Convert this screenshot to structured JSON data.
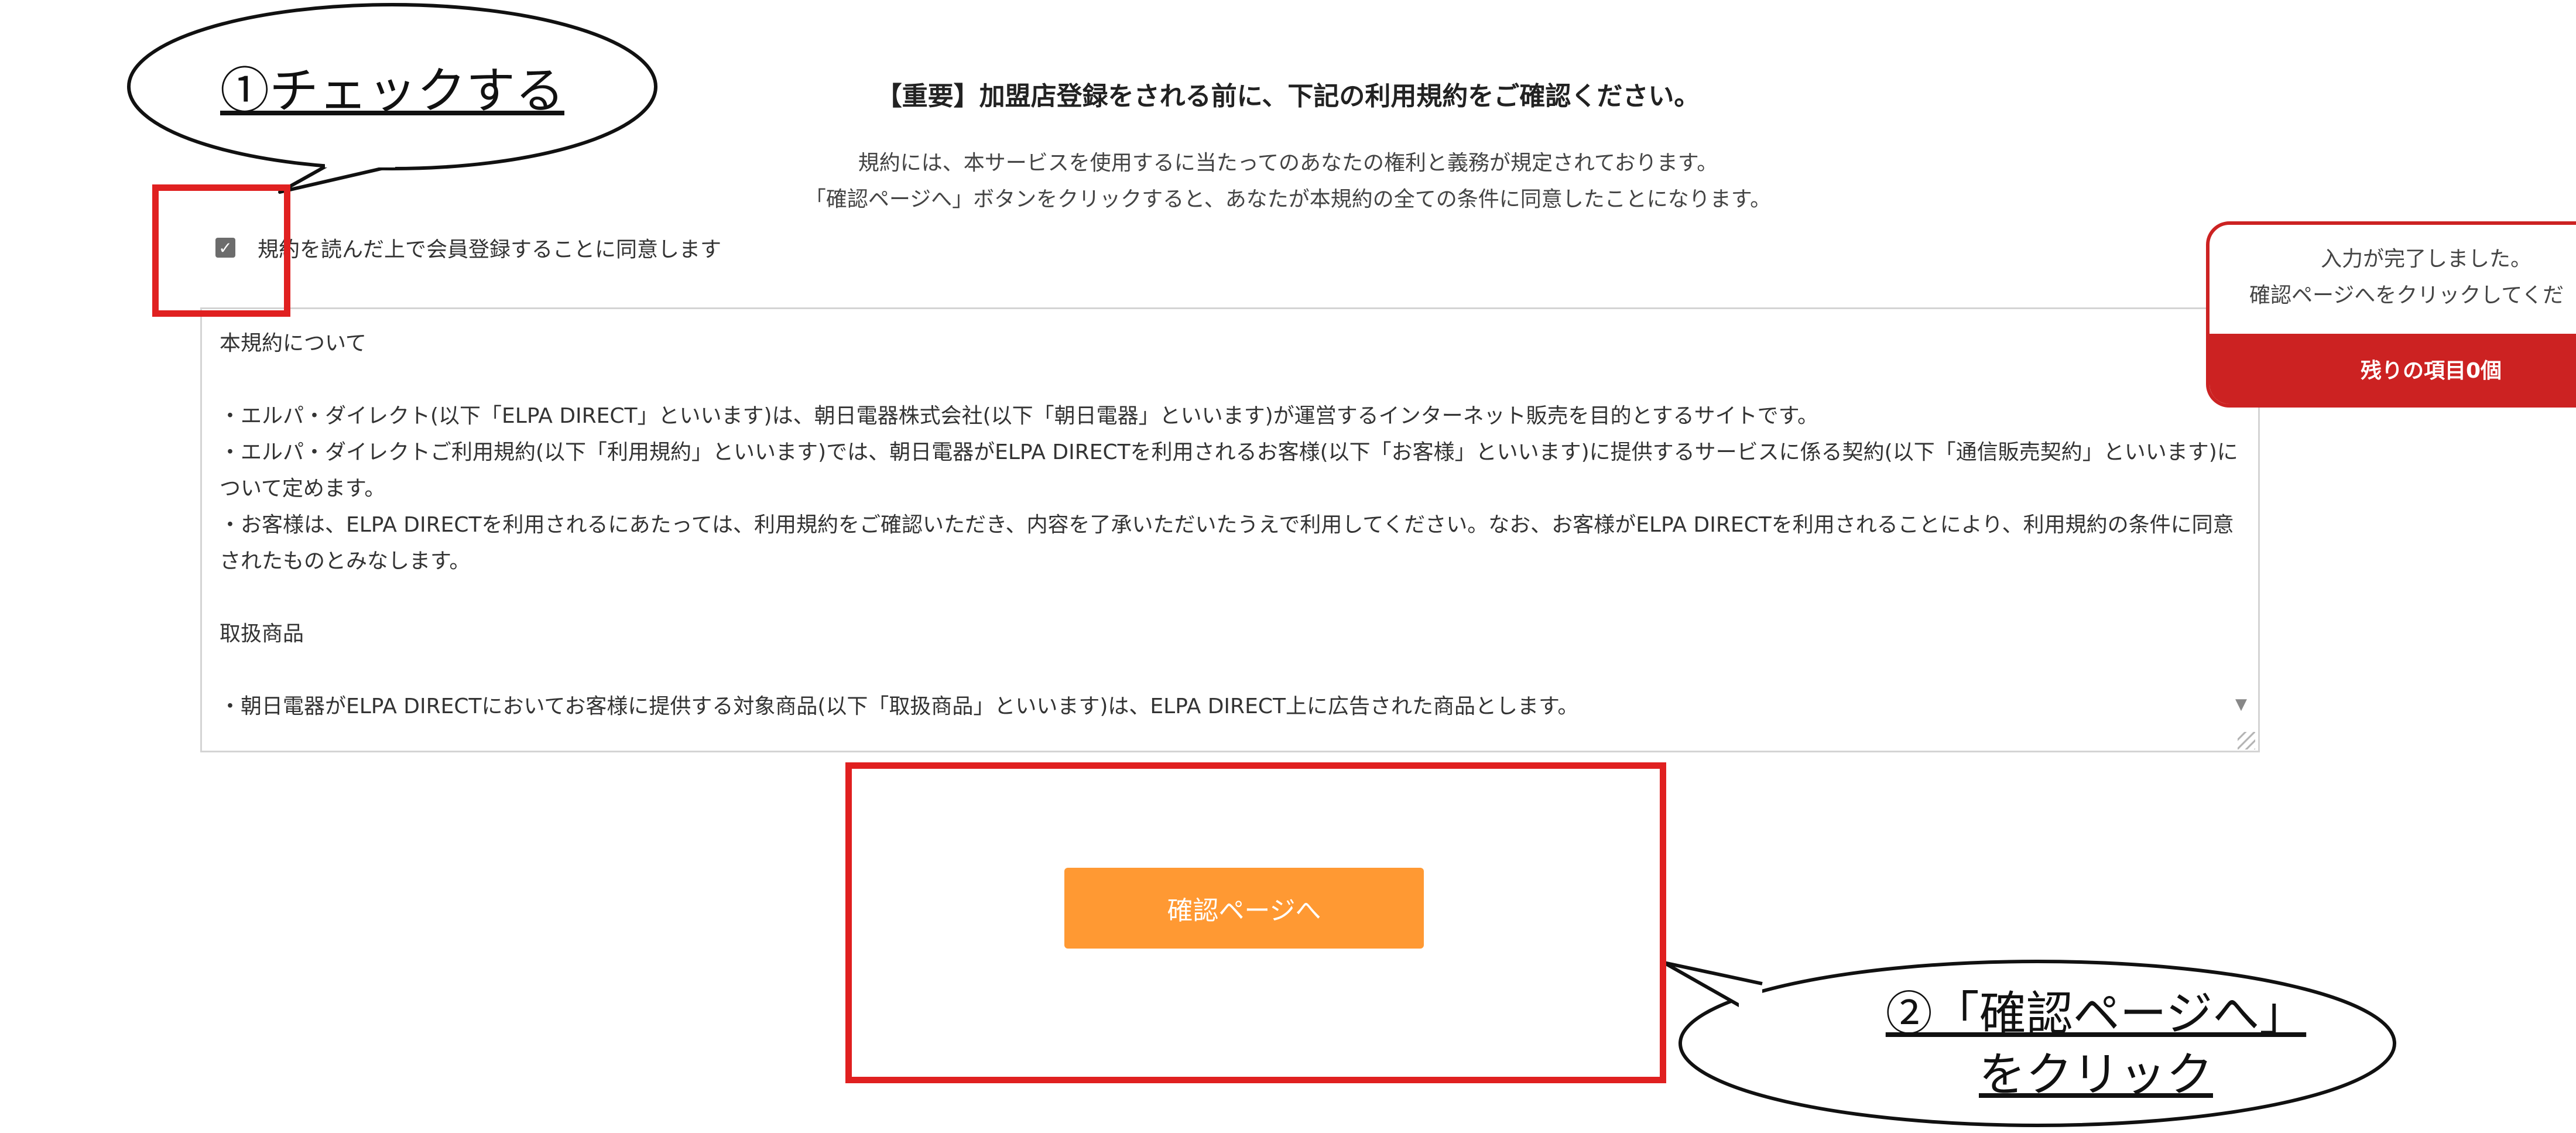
{
  "heading": "【重要】加盟店登録をされる前に、下記の利用規約をご確認ください。",
  "intro": [
    "規約には、本サービスを使用するに当たってのあなたの権利と義務が規定されております。",
    "「確認ページへ」ボタンをクリックすると、あなたが本規約の全ての条件に同意したことになります。"
  ],
  "agree": {
    "checked": true,
    "label": "規約を読んだ上で会員登録することに同意します"
  },
  "terms": {
    "section1_title": "本規約について",
    "p1": "・エルパ・ダイレクト(以下「ELPA DIRECT」といいます)は、朝日電器株式会社(以下「朝日電器」といいます)が運営するインターネット販売を目的とするサイトです。",
    "p2": "・エルパ・ダイレクトご利用規約(以下「利用規約」といいます)では、朝日電器がELPA DIRECTを利用されるお客様(以下「お客様」といいます)に提供するサービスに係る契約(以下「通信販売契約」といいます)について定めます。",
    "p3": "・お客様は、ELPA DIRECTを利用されるにあたっては、利用規約をご確認いただき、内容を了承いただいたうえで利用してください。なお、お客様がELPA DIRECTを利用されることにより、利用規約の条件に同意されたものとみなします。",
    "section2_title": "取扱商品",
    "p4": "・朝日電器がELPA DIRECTにおいてお客様に提供する対象商品(以下「取扱商品」といいます)は、ELPA DIRECT上に広告された商品とします。"
  },
  "confirm_button": "確認ページへ",
  "callout1": "①チェックする",
  "callout2": {
    "line1": "②「確認ページへ」",
    "line2": "をクリック"
  },
  "toast": {
    "line1": "入力が完了しました。",
    "line2": "確認ページへをクリックしてくだ",
    "remaining": "残りの項目0個"
  },
  "colors": {
    "button": "#ff9933",
    "annotation_red": "#e02020",
    "toast_red": "#cc2222"
  }
}
